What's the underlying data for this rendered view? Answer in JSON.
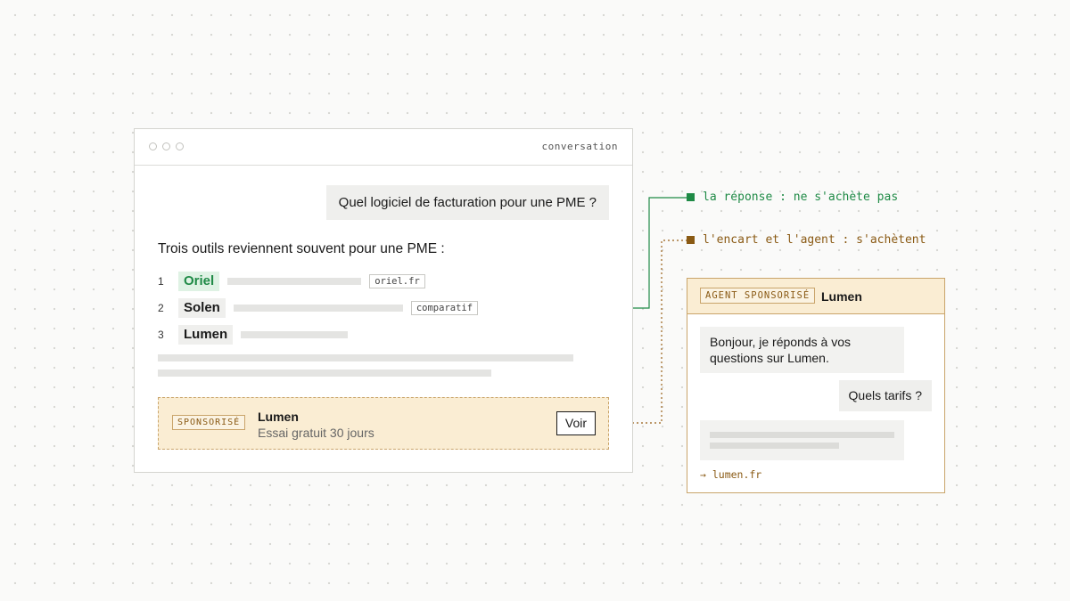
{
  "window": {
    "title": "conversation",
    "user_question": "Quel logiciel de facturation pour une PME ?",
    "answer_intro": "Trois outils reviennent souvent pour une PME :",
    "tools": [
      {
        "num": "1",
        "name": "Oriel",
        "tag": "oriel.fr"
      },
      {
        "num": "2",
        "name": "Solen",
        "tag": "comparatif"
      },
      {
        "num": "3",
        "name": "Lumen",
        "tag": ""
      }
    ],
    "sponsor": {
      "badge": "SPONSORISÉ",
      "title": "Lumen",
      "subtitle": "Essai gratuit 30 jours",
      "button": "Voir"
    }
  },
  "legend": {
    "answer": "la réponse : ne s'achète pas",
    "paid": "l'encart et l'agent : s'achètent"
  },
  "agent": {
    "badge": "AGENT SPONSORISÉ",
    "name": "Lumen",
    "bot_message": "Bonjour, je réponds à vos questions sur Lumen.",
    "user_message": "Quels tarifs ?",
    "link": "→ lumen.fr"
  },
  "colors": {
    "organic": "#1f8a46",
    "paid": "#8a5a14",
    "paid_background": "#faedd3"
  }
}
